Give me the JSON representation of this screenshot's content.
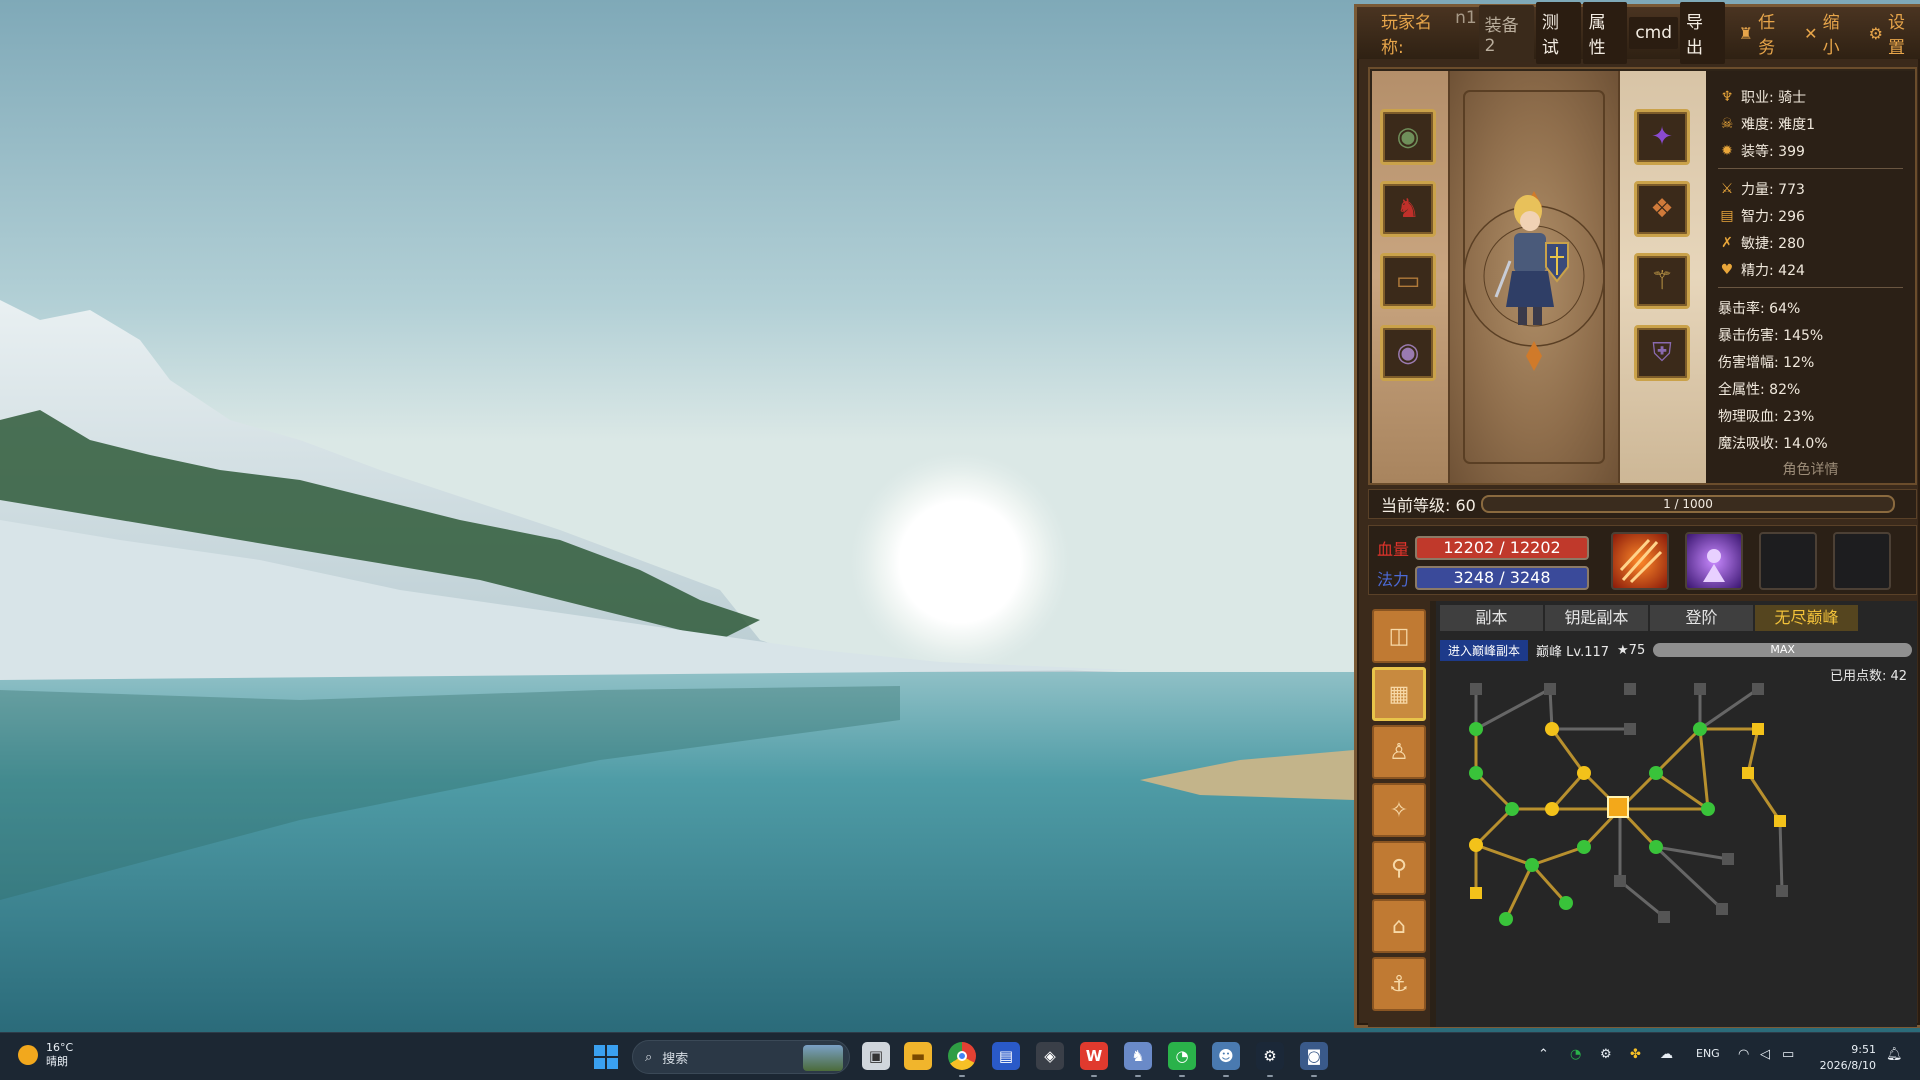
{
  "game": {
    "player_label": "玩家名称:",
    "player_value": "n1",
    "tabs": [
      "装备2",
      "测试",
      "属性",
      "cmd",
      "导出"
    ],
    "actions": [
      {
        "icon": "quest-icon",
        "glyph": "♜",
        "label": "任务"
      },
      {
        "icon": "shrink-icon",
        "glyph": "✕",
        "label": "缩小"
      },
      {
        "icon": "gear-icon",
        "glyph": "⚙",
        "label": "设置"
      }
    ],
    "stats": {
      "class": "职业: 骑士",
      "difficulty": "难度: 难度1",
      "gear_score": "装等: 399",
      "strength": "力量: 773",
      "intellect": "智力: 296",
      "agility": "敏捷: 280",
      "spirit": "精力: 424",
      "crit_rate": "暴击率: 64%",
      "crit_damage": "暴击伤害: 145%",
      "damage_bonus": "伤害增幅: 12%",
      "all_attributes": "全属性: 82%",
      "physical_leech": "物理吸血: 23%",
      "magic_absorb": "魔法吸收: 14.0%",
      "detail_link": "角色详情"
    },
    "level": {
      "label": "当前等级: 60",
      "exp": "1 / 1000",
      "exp_fraction": 0.001
    },
    "hp": {
      "label": "血量",
      "value": "12202 / 12202",
      "color": "#c0392b"
    },
    "mp": {
      "label": "法力",
      "value": "3248 / 3248",
      "color": "#3a4a9a"
    },
    "lower_tabs": [
      "副本",
      "钥匙副本",
      "登阶",
      "无尽巅峰"
    ],
    "selected_tab": 3,
    "peak": {
      "enter": "进入巅峰副本",
      "level": "巅峰 Lv.117",
      "stars": "★75",
      "bar": "MAX"
    },
    "points": "已用点数: 42"
  },
  "taskbar": {
    "weather_temp": "16°C",
    "weather_desc": "晴朗",
    "search_placeholder": "搜索",
    "lang": "ENG",
    "time": "9:51",
    "date": "2026/8/10"
  }
}
